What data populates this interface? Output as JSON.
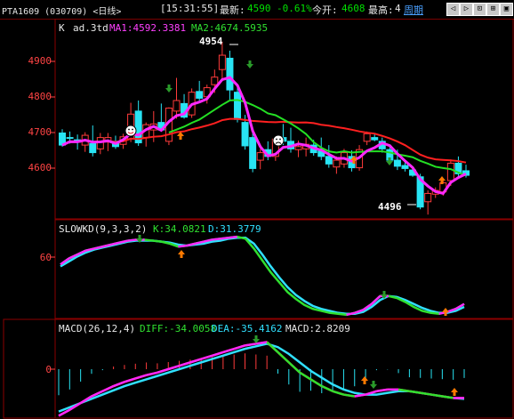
{
  "header": {
    "symbol": "PTA1609 (030709)  <日线>",
    "time": "[15:31:55]",
    "latest_label": "最新:",
    "latest_value": "4590",
    "change_pct": "-0.61%",
    "open_label": "今开:",
    "open_value": "4608",
    "high_label": "最高:",
    "high_value": "4",
    "cycle_label": "周期",
    "nav_buttons": [
      "◁",
      "▷",
      "⊡",
      "⊞",
      "▣"
    ]
  },
  "main_panel": {
    "indicator_name": "K",
    "adjust_label": "ad.3td",
    "ma1_label": "MA1:4592.3381",
    "ma2_label": "MA2:4674.5935",
    "y_ticks": [
      "4900",
      "4800",
      "4700",
      "4600"
    ],
    "high_marker": "4954",
    "low_marker": "4496"
  },
  "kd_panel": {
    "name": "SLOWKD(9,3,3,2)",
    "k_label": "K:34.0821",
    "d_label": "D:31.3779",
    "y_ticks": [
      "60"
    ]
  },
  "macd_panel": {
    "name": "MACD(26,12,4)",
    "diff_label": "DIFF:-34.0058",
    "dea_label": "DEA:-35.4162",
    "macd_label": "MACD:2.8209",
    "y_ticks": [
      "0"
    ]
  },
  "colors": {
    "up": "#ff3b3b",
    "down": "#28e4f4",
    "ma1": "#ff28ff",
    "ma2": "#24e024",
    "ma_red": "#ff2020",
    "grid_frame": "#8b0000"
  },
  "chart_data": [
    {
      "type": "candlestick",
      "ylim": [
        4480,
        5010
      ],
      "candles": [
        [
          4712,
          4722,
          4676,
          4680
        ],
        [
          4700,
          4716,
          4684,
          4698
        ],
        [
          4694,
          4708,
          4668,
          4688
        ],
        [
          4680,
          4714,
          4662,
          4706
        ],
        [
          4684,
          4732,
          4650,
          4660
        ],
        [
          4670,
          4712,
          4656,
          4700
        ],
        [
          4688,
          4712,
          4664,
          4700
        ],
        [
          4690,
          4705,
          4670,
          4676
        ],
        [
          4682,
          4710,
          4670,
          4702
        ],
        [
          4696,
          4792,
          4688,
          4762
        ],
        [
          4770,
          4798,
          4678,
          4686
        ],
        [
          4700,
          4740,
          4676,
          4734
        ],
        [
          4720,
          4770,
          4688,
          4736
        ],
        [
          4740,
          4790,
          4716,
          4720
        ],
        [
          4690,
          4780,
          4680,
          4778
        ],
        [
          4770,
          4858,
          4750,
          4798
        ],
        [
          4790,
          4815,
          4750,
          4754
        ],
        [
          4760,
          4830,
          4752,
          4820
        ],
        [
          4822,
          4850,
          4798,
          4804
        ],
        [
          4808,
          4840,
          4790,
          4832
        ],
        [
          4840,
          4880,
          4818,
          4860
        ],
        [
          4880,
          4954,
          4852,
          4918
        ],
        [
          4910,
          4930,
          4800,
          4826
        ],
        [
          4820,
          4836,
          4740,
          4748
        ],
        [
          4740,
          4760,
          4668,
          4678
        ],
        [
          4700,
          4722,
          4608,
          4618
        ],
        [
          4640,
          4670,
          4616,
          4660
        ],
        [
          4668,
          4690,
          4640,
          4650
        ],
        [
          4650,
          4700,
          4638,
          4696
        ],
        [
          4700,
          4736,
          4680,
          4690
        ],
        [
          4690,
          4726,
          4660,
          4670
        ],
        [
          4668,
          4692,
          4648,
          4676
        ],
        [
          4670,
          4700,
          4650,
          4682
        ],
        [
          4680,
          4694,
          4652,
          4660
        ],
        [
          4664,
          4700,
          4640,
          4650
        ],
        [
          4650,
          4680,
          4620,
          4630
        ],
        [
          4622,
          4650,
          4604,
          4640
        ],
        [
          4630,
          4670,
          4620,
          4660
        ],
        [
          4650,
          4666,
          4610,
          4620
        ],
        [
          4620,
          4680,
          4612,
          4668
        ],
        [
          4690,
          4716,
          4680,
          4710
        ],
        [
          4700,
          4712,
          4690,
          4694
        ],
        [
          4690,
          4700,
          4660,
          4670
        ],
        [
          4668,
          4680,
          4632,
          4640
        ],
        [
          4640,
          4668,
          4614,
          4624
        ],
        [
          4626,
          4640,
          4610,
          4618
        ],
        [
          4614,
          4620,
          4596,
          4600
        ],
        [
          4596,
          4604,
          4510,
          4516
        ],
        [
          4530,
          4560,
          4496,
          4552
        ],
        [
          4550,
          4568,
          4540,
          4560
        ],
        [
          4556,
          4588,
          4546,
          4580
        ],
        [
          4586,
          4642,
          4572,
          4632
        ],
        [
          4632,
          4650,
          4596,
          4604
        ],
        [
          4612,
          4628,
          4594,
          4600
        ]
      ]
    },
    {
      "type": "line",
      "series": [
        {
          "name": "K",
          "values": [
            52,
            58,
            62,
            66,
            68,
            70,
            72,
            74,
            76,
            77,
            77,
            76,
            75,
            73,
            70,
            71,
            73,
            75,
            77,
            78,
            79,
            80,
            78,
            68,
            56,
            44,
            34,
            24,
            17,
            11,
            7,
            5,
            3,
            2,
            1,
            3,
            6,
            12,
            20,
            20,
            18,
            14,
            9,
            5,
            3,
            2,
            4,
            7,
            12
          ]
        },
        {
          "name": "D",
          "values": [
            50,
            55,
            60,
            64,
            67,
            69,
            71,
            73,
            75,
            76,
            76,
            76,
            75,
            74,
            72,
            71,
            72,
            73,
            75,
            76,
            78,
            79,
            79,
            73,
            62,
            50,
            39,
            29,
            21,
            15,
            10,
            7,
            5,
            3,
            2,
            2,
            4,
            9,
            16,
            20,
            19,
            16,
            12,
            8,
            5,
            3,
            3,
            5,
            9
          ]
        }
      ],
      "ylim": [
        0,
        90
      ]
    },
    {
      "type": "line",
      "series": [
        {
          "name": "DIFF",
          "values": [
            -55,
            -48,
            -40,
            -32,
            -26,
            -20,
            -15,
            -11,
            -7,
            -4,
            0,
            4,
            8,
            12,
            16,
            20,
            24,
            28,
            30,
            32,
            20,
            8,
            -4,
            -12,
            -20,
            -26,
            -30,
            -32,
            -30,
            -26,
            -24,
            -24,
            -26,
            -28,
            -30,
            -32,
            -34,
            -34
          ]
        },
        {
          "name": "DEA",
          "values": [
            -50,
            -45,
            -40,
            -35,
            -30,
            -25,
            -20,
            -16,
            -12,
            -8,
            -4,
            0,
            4,
            8,
            12,
            16,
            20,
            24,
            27,
            30,
            26,
            18,
            8,
            -2,
            -10,
            -18,
            -24,
            -28,
            -30,
            -30,
            -28,
            -26,
            -26,
            -28,
            -30,
            -32,
            -34,
            -35
          ]
        }
      ],
      "ylim": [
        -60,
        45
      ]
    }
  ]
}
